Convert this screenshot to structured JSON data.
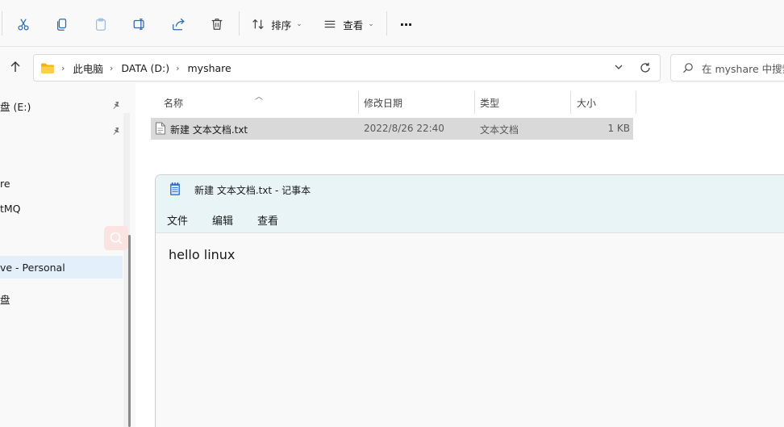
{
  "toolbar": {
    "sort_label": "排序",
    "view_label": "查看",
    "more_label": "···"
  },
  "address": {
    "crumbs": [
      "此电脑",
      "DATA (D:)",
      "myshare"
    ]
  },
  "search": {
    "placeholder": "在 myshare 中搜索"
  },
  "nav": {
    "items": [
      {
        "label": "盘 (E:)"
      },
      {
        "label": "re"
      },
      {
        "label": "tMQ"
      },
      {
        "label": "ve - Personal"
      },
      {
        "label": "盘"
      }
    ]
  },
  "columns": {
    "name": "名称",
    "modified": "修改日期",
    "type": "类型",
    "size": "大小"
  },
  "files": [
    {
      "name": "新建 文本文档.txt",
      "modified": "2022/8/26 22:40",
      "type": "文本文档",
      "size": "1 KB"
    }
  ],
  "notepad": {
    "title": "新建 文本文档.txt - 记事本",
    "menu": [
      "文件",
      "编辑",
      "查看"
    ],
    "content": "hello linux"
  },
  "colors": {
    "selected_row": "#d9d9d9",
    "nav_selected": "#e3effa",
    "accent": "#0067c0",
    "folder": "#f4b400"
  }
}
